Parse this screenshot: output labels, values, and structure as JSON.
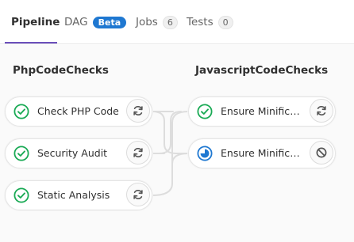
{
  "tabs": {
    "pipeline": "Pipeline",
    "dag": "DAG",
    "dag_badge": "Beta",
    "jobs": "Jobs",
    "jobs_count": "6",
    "tests": "Tests",
    "tests_count": "0"
  },
  "stages": [
    {
      "name": "PhpCodeChecks",
      "jobs": [
        {
          "name": "Check PHP Code",
          "status": "success",
          "action": "retry"
        },
        {
          "name": "Security Audit",
          "status": "success",
          "action": "retry"
        },
        {
          "name": "Static Analysis",
          "status": "success",
          "action": "retry"
        }
      ]
    },
    {
      "name": "JavascriptCodeChecks",
      "jobs": [
        {
          "name": "Ensure Minificati...",
          "status": "success",
          "action": "retry"
        },
        {
          "name": "Ensure Minificati...",
          "status": "running",
          "action": "cancel"
        }
      ]
    }
  ],
  "colors": {
    "success": "#1aaa55",
    "running": "#1f78d1",
    "accent": "#6b4fbb",
    "badge": "#1f78d1"
  },
  "icons": {
    "success": "check-circle-icon",
    "running": "running-icon",
    "retry": "retry-icon",
    "cancel": "cancel-icon"
  }
}
